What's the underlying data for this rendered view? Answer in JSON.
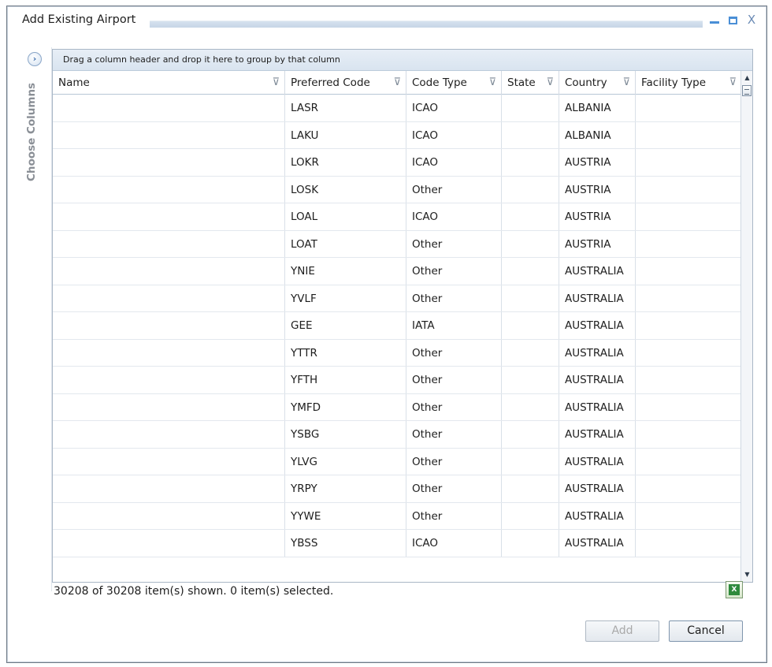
{
  "window": {
    "title": "Add Existing Airport",
    "controls": {
      "minimize_icon": "minimize-icon",
      "maximize_icon": "maximize-icon",
      "close_label": "X"
    }
  },
  "side_panel": {
    "label": "Choose Columns",
    "expand_glyph": "›"
  },
  "grid": {
    "group_hint": "Drag a column header and drop it here to group by that column",
    "columns": [
      {
        "key": "name",
        "label": "Name"
      },
      {
        "key": "preferred_code",
        "label": "Preferred Code"
      },
      {
        "key": "code_type",
        "label": "Code Type"
      },
      {
        "key": "state",
        "label": "State"
      },
      {
        "key": "country",
        "label": "Country"
      },
      {
        "key": "facility_type",
        "label": "Facility Type"
      }
    ],
    "rows": [
      {
        "name": "",
        "preferred_code": "LASR",
        "code_type": "ICAO",
        "state": "",
        "country": "ALBANIA",
        "facility_type": ""
      },
      {
        "name": "",
        "preferred_code": "LAKU",
        "code_type": "ICAO",
        "state": "",
        "country": "ALBANIA",
        "facility_type": ""
      },
      {
        "name": "",
        "preferred_code": "LOKR",
        "code_type": "ICAO",
        "state": "",
        "country": "AUSTRIA",
        "facility_type": ""
      },
      {
        "name": "",
        "preferred_code": "LOSK",
        "code_type": "Other",
        "state": "",
        "country": "AUSTRIA",
        "facility_type": ""
      },
      {
        "name": "",
        "preferred_code": "LOAL",
        "code_type": "ICAO",
        "state": "",
        "country": "AUSTRIA",
        "facility_type": ""
      },
      {
        "name": "",
        "preferred_code": "LOAT",
        "code_type": "Other",
        "state": "",
        "country": "AUSTRIA",
        "facility_type": ""
      },
      {
        "name": "",
        "preferred_code": "YNIE",
        "code_type": "Other",
        "state": "",
        "country": "AUSTRALIA",
        "facility_type": ""
      },
      {
        "name": "",
        "preferred_code": "YVLF",
        "code_type": "Other",
        "state": "",
        "country": "AUSTRALIA",
        "facility_type": ""
      },
      {
        "name": "",
        "preferred_code": "GEE",
        "code_type": "IATA",
        "state": "",
        "country": "AUSTRALIA",
        "facility_type": ""
      },
      {
        "name": "",
        "preferred_code": "YTTR",
        "code_type": "Other",
        "state": "",
        "country": "AUSTRALIA",
        "facility_type": ""
      },
      {
        "name": "",
        "preferred_code": "YFTH",
        "code_type": "Other",
        "state": "",
        "country": "AUSTRALIA",
        "facility_type": ""
      },
      {
        "name": "",
        "preferred_code": "YMFD",
        "code_type": "Other",
        "state": "",
        "country": "AUSTRALIA",
        "facility_type": ""
      },
      {
        "name": "",
        "preferred_code": "YSBG",
        "code_type": "Other",
        "state": "",
        "country": "AUSTRALIA",
        "facility_type": ""
      },
      {
        "name": "",
        "preferred_code": "YLVG",
        "code_type": "Other",
        "state": "",
        "country": "AUSTRALIA",
        "facility_type": ""
      },
      {
        "name": "",
        "preferred_code": "YRPY",
        "code_type": "Other",
        "state": "",
        "country": "AUSTRALIA",
        "facility_type": ""
      },
      {
        "name": "",
        "preferred_code": "YYWE",
        "code_type": "Other",
        "state": "",
        "country": "AUSTRALIA",
        "facility_type": ""
      },
      {
        "name": "",
        "preferred_code": "YBSS",
        "code_type": "ICAO",
        "state": "",
        "country": "AUSTRALIA",
        "facility_type": ""
      }
    ]
  },
  "status": {
    "text": "30208 of 30208 item(s) shown. 0 item(s) selected."
  },
  "export": {
    "icon": "excel-export-icon",
    "glyph": "X"
  },
  "buttons": {
    "add": "Add",
    "cancel": "Cancel"
  },
  "colors": {
    "accent": "#4a8fd6",
    "border": "#a9b7c6",
    "disabled_text": "#a9a9a9"
  }
}
